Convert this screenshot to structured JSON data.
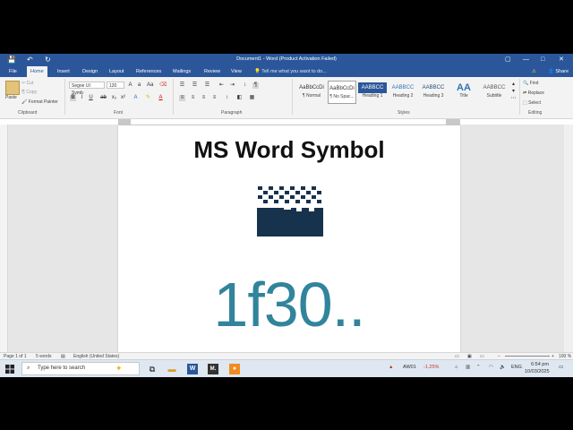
{
  "titlebar": {
    "title": "Document1 - Word (Product Activation Failed)",
    "save_glyph": "💾",
    "undo_glyph": "↶",
    "redo_glyph": "↻",
    "restore_glyph": "▢",
    "min_glyph": "—",
    "max_glyph": "□",
    "close_glyph": "✕"
  },
  "tabs": [
    "File",
    "Home",
    "Insert",
    "Design",
    "Layout",
    "References",
    "Mailings",
    "Review",
    "View"
  ],
  "tell_me": "Tell me what you want to do...",
  "share": "Share",
  "warning_glyph": "⚠",
  "clipboard": {
    "paste": "Paste",
    "cut": "Cut",
    "copy": "Copy",
    "format_painter": "Format Painter",
    "label": "Clipboard"
  },
  "font": {
    "name": "Segoe UI Symb",
    "size": "120",
    "label": "Font"
  },
  "paragraph": {
    "label": "Paragraph"
  },
  "styles": {
    "label": "Styles",
    "items": [
      {
        "sample": "AaBbCcDi",
        "name": "¶ Normal"
      },
      {
        "sample": "AaBbCcDi",
        "name": "¶ No Spac..."
      },
      {
        "sample": "AABBCC",
        "name": "Heading 1"
      },
      {
        "sample": "AABBCC",
        "name": "Heading 2"
      },
      {
        "sample": "AABBCC",
        "name": "Heading 3"
      },
      {
        "sample": "AA",
        "name": "Title"
      },
      {
        "sample": "AABBCC",
        "name": "Subtitle"
      }
    ]
  },
  "editing": {
    "find": "Find",
    "replace": "Replace",
    "select": "Select",
    "label": "Editing"
  },
  "document": {
    "heading": "MS Word Symbol",
    "big_text": "1f30..",
    "heading_color": "#111111",
    "big_text_color": "#31849b",
    "symbol_color": "#17324d"
  },
  "status": {
    "page": "Page 1 of 1",
    "words": "5 words",
    "language": "English (United States)",
    "zoom": "100 %"
  },
  "taskbar": {
    "search_placeholder": "Type here to search",
    "ticker": "AW01",
    "change": "-1.25%",
    "lang": "ENG",
    "time": "6:54 pm",
    "date": "10/03/2025"
  }
}
